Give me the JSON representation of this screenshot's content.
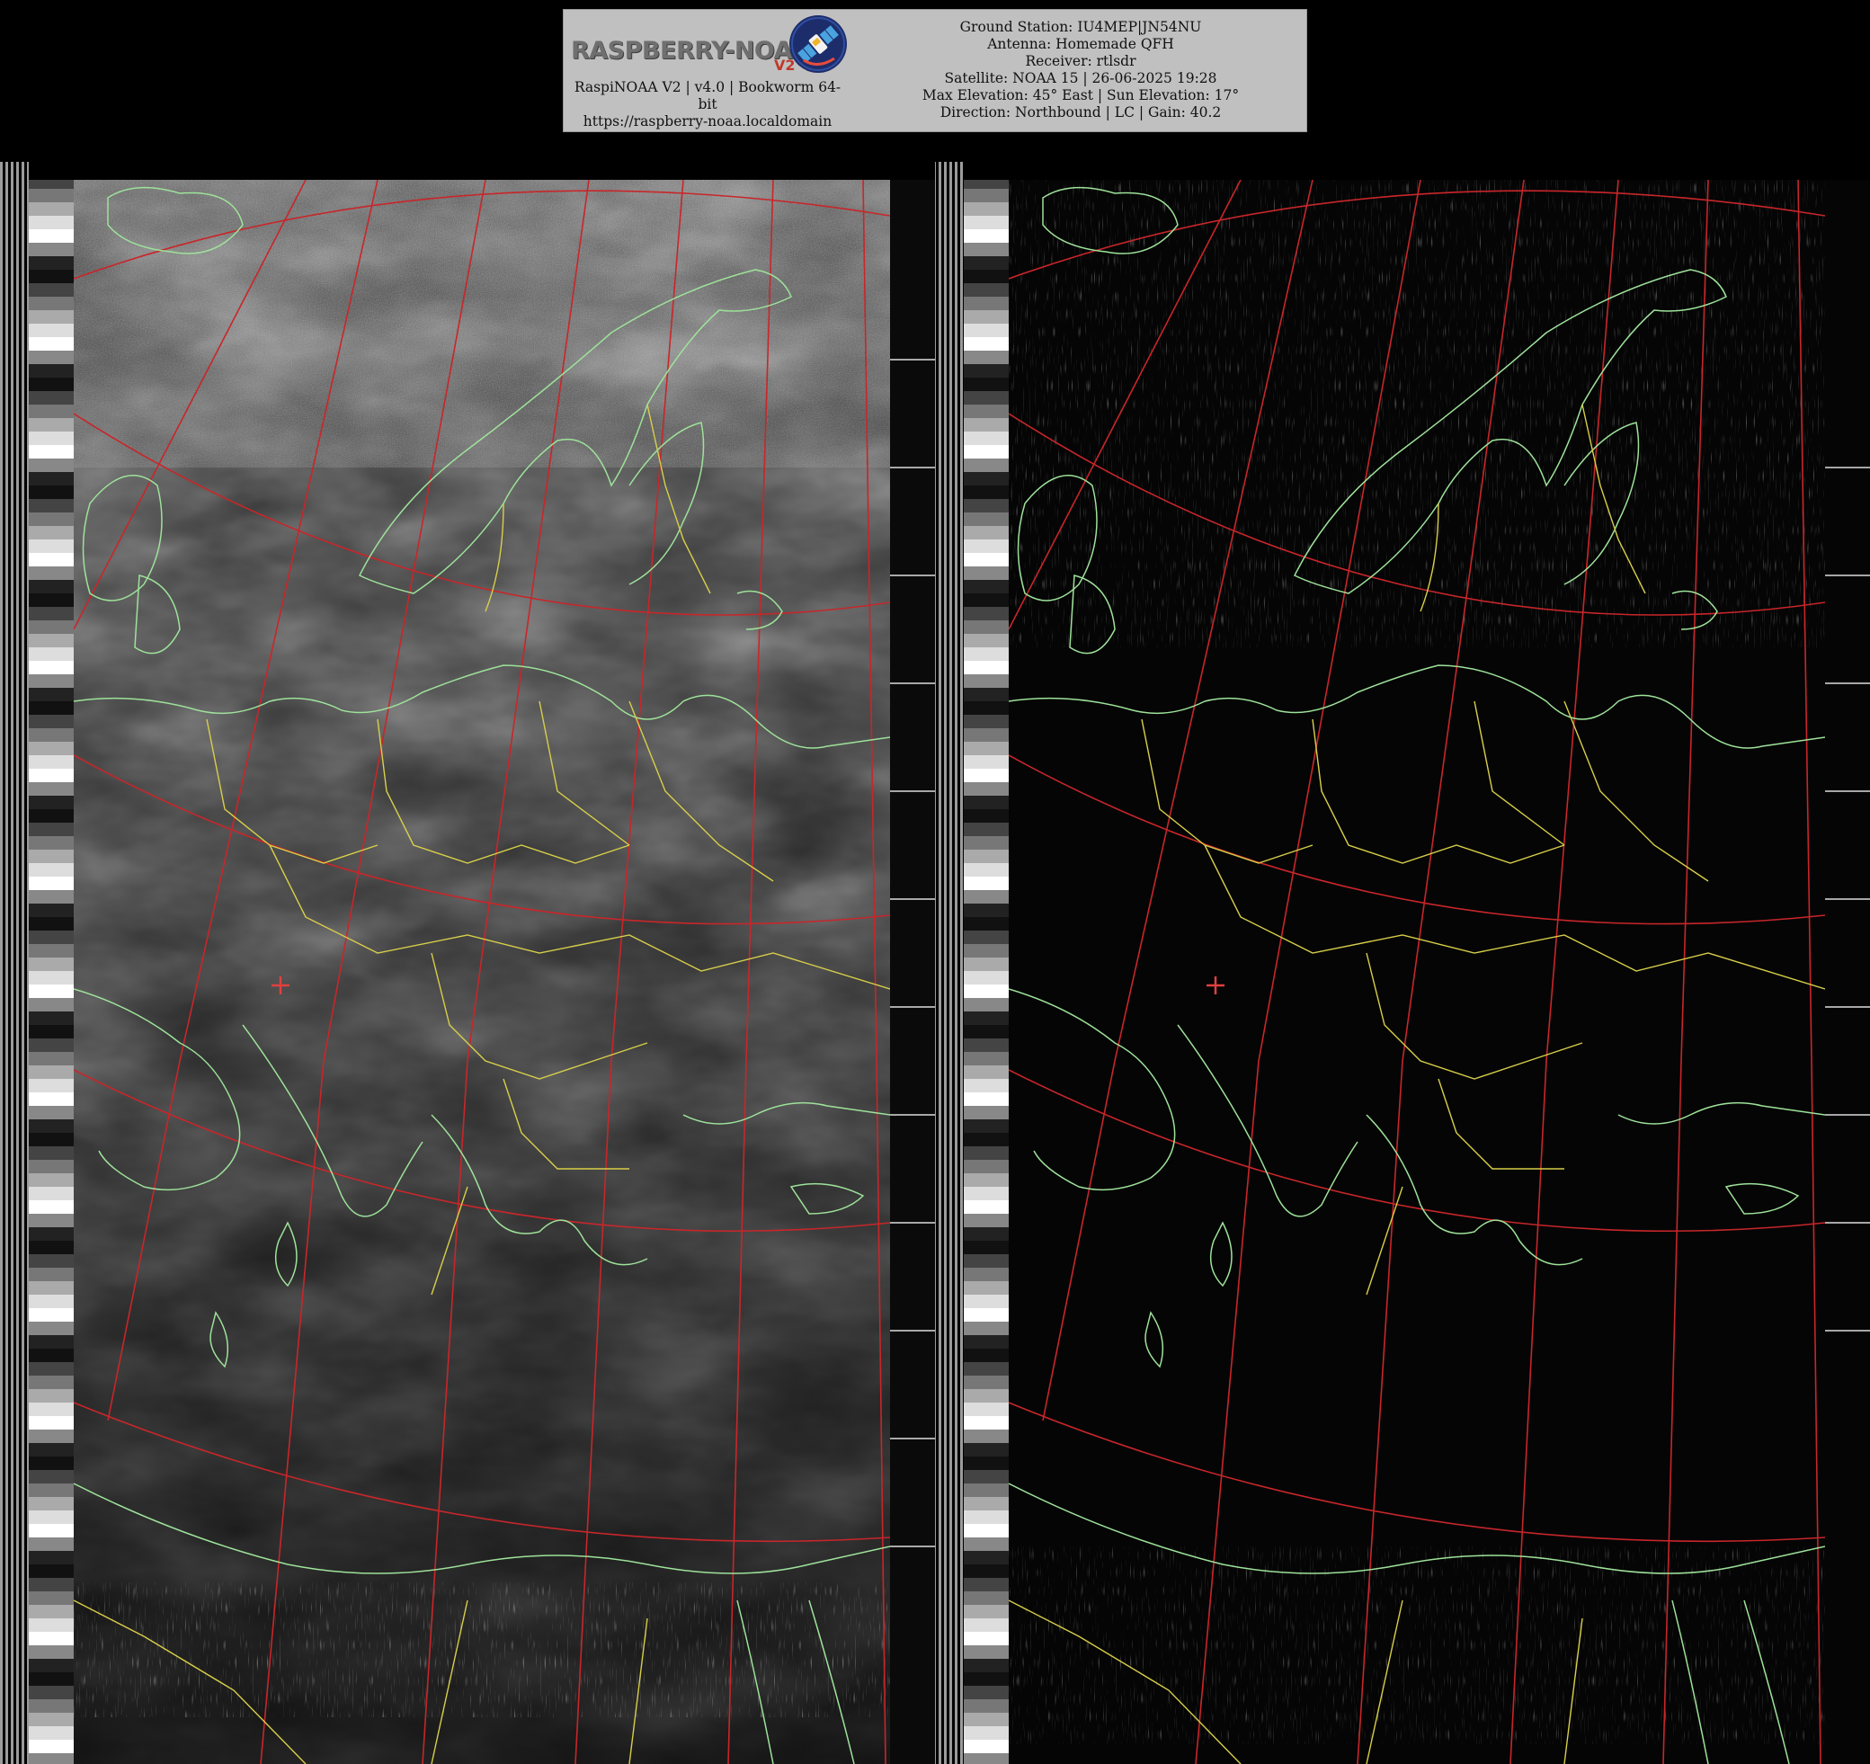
{
  "logo": {
    "text": "RASPBERRY-NOAA",
    "version_mark": "V2"
  },
  "left_caption": {
    "line1": "RaspiNOAA V2 | v4.0 | Bookworm 64-",
    "line2": "bit",
    "line3": "https://raspberry-noaa.localdomain"
  },
  "pass_info": {
    "ground_station": "Ground Station: IU4MEP|JN54NU",
    "antenna": "Antenna: Homemade QFH",
    "receiver": "Receiver: rtlsdr",
    "satellite": "Satellite: NOAA 15 | 26-06-2025 19:28",
    "elevation": "Max Elevation: 45° East | Sun Elevation: 17°",
    "direction": "Direction: Northbound | LC | Gain: 40.2"
  },
  "colors": {
    "background": "#000000",
    "header_box": "#c0c0c0",
    "graticule": "#c8262a",
    "coastline": "#9ee29a",
    "borders": "#d8cf4a",
    "marker": "#e0403f"
  },
  "icons": {
    "logo_badge": "satellite-icon",
    "location_marker": "crosshair-icon"
  }
}
